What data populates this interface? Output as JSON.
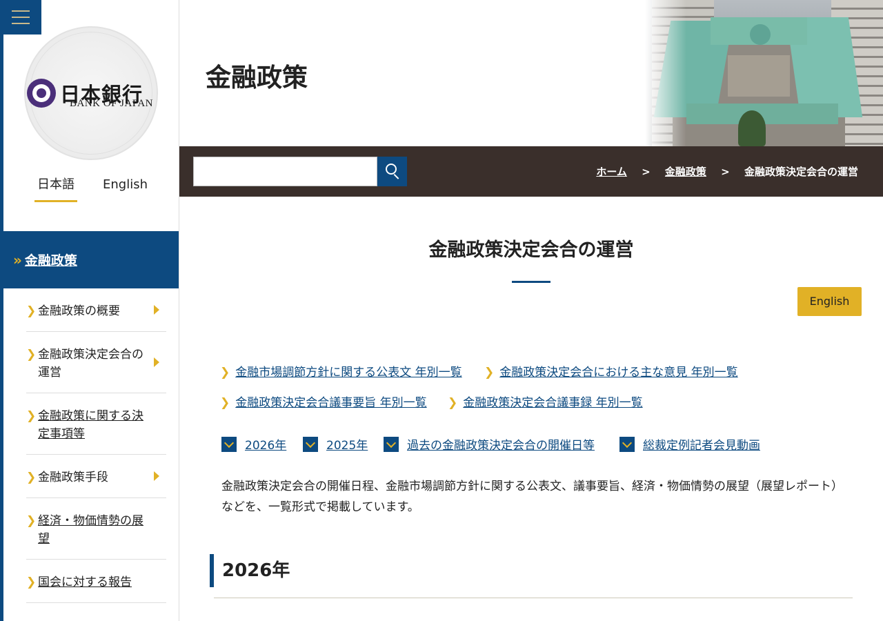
{
  "logo": {
    "text_jp": "日本銀行",
    "text_en": "BANK OF JAPAN"
  },
  "language_tabs": [
    {
      "label": "日本語",
      "active": true
    },
    {
      "label": "English",
      "active": false
    }
  ],
  "sidebar": {
    "section_label": "金融政策",
    "items": [
      {
        "label": "金融政策の概要"
      },
      {
        "label": "金融政策決定会合の運営"
      },
      {
        "label": "金融政策に関する決定事項等"
      },
      {
        "label": "金融政策手段"
      },
      {
        "label": "経済・物価情勢の展望"
      },
      {
        "label": "国会に対する報告"
      }
    ]
  },
  "header": {
    "page_title": "金融政策"
  },
  "search": {
    "value": ""
  },
  "breadcrumb": {
    "home": "ホーム",
    "section": "金融政策",
    "current": "金融政策決定会合の運営",
    "separator": ">"
  },
  "main": {
    "title": "金融政策決定会合の運営",
    "english_button": "English",
    "quick_links": [
      "金融市場調節方針に関する公表文 年別一覧",
      "金融政策決定会合における主な意見 年別一覧",
      "金融政策決定会合議事要旨 年別一覧",
      "金融政策決定会合議事録 年別一覧"
    ],
    "anchors": [
      "2026年",
      "2025年",
      "過去の金融政策決定会合の開催日等",
      "総裁定例記者会見動画"
    ],
    "intro": "金融政策決定会合の開催日程、金融市場調節方針に関する公表文、議事要旨、経済・物価情勢の展望（展望レポート）などを、一覧形式で掲載しています。",
    "year_heading": "2026年"
  },
  "colors": {
    "brand_blue": "#0d4a80",
    "accent_gold": "#e1b126",
    "band_dark": "#3a2f2b"
  },
  "icons": {
    "menu": "hamburger-icon",
    "search": "search-icon",
    "chevron": "chevron-right-icon",
    "anchor": "chevron-down-icon"
  }
}
